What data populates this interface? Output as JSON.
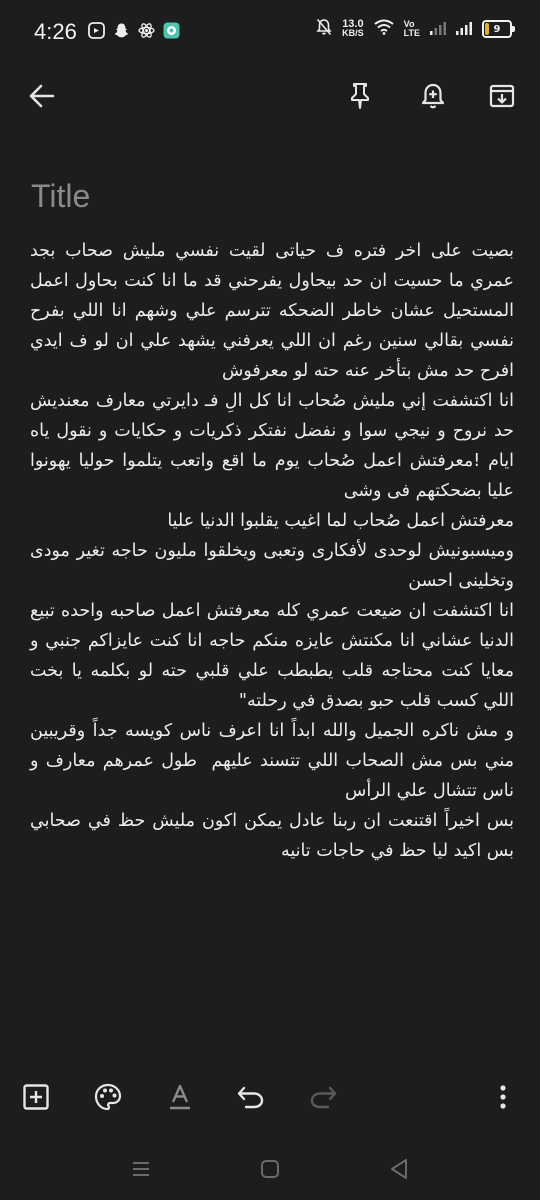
{
  "status_bar": {
    "time": "4:26",
    "net_speed_value": "13.0",
    "net_speed_unit": "KB/S",
    "volte_top": "Vo",
    "volte_bottom": "LTE",
    "battery_level": "9",
    "icons": [
      "notification-app-icon",
      "snapchat-icon",
      "react-icon",
      "messaging-app-icon",
      "mute-bell-icon",
      "wifi-icon",
      "signal-icon",
      "signal-icon",
      "battery-icon"
    ]
  },
  "toolbar": {
    "icons": [
      "back-arrow-icon",
      "pin-icon",
      "add-reminder-icon",
      "archive-icon"
    ]
  },
  "note": {
    "title_placeholder": "Title",
    "body": "بصيت على اخر فتره ف حياتى لقيت نفسي مليش صحاب بجد عمري ما حسيت ان حد بيحاول يفرحني قد ما انا كنت بحاول اعمل المستحيل عشان خاطر الضحكه تترسم علي وشهم انا اللي بفرح نفسي بقالي سنين رغم ان اللي يعرفني يشهد علي ان لو ف ايدي افرح حد مش بتأخر عنه حته لو معرفوش\nانا اكتشفت إني مليش صُحاب انا كل الِ فـ دايرتي معارف معنديش حد نروح و نيجي سوا و نفضل نفتكر ذكريات و حكايات و نقول ياه ايام !معرفتش اعمل صُحاب يوم ما اقع واتعب يتلموا حوليا يهونوا عليا بضحكتهم فى وشى\nمعرفتش اعمل صُحاب لما اغيب يقلبوا الدنيا عليا\nوميسبونيش لوحدى لأفكارى وتعبى ويخلقوا مليون حاجه تغير مودى وتخلينى احسن\nانا اكتشفت ان ضيعت عمري كله معرفتش اعمل صاحبه واحده تبيع الدنيا عشاني انا مكنتش عايزه منكم حاجه انا كنت عايزاكم جنبي و معايا كنت محتاجه قلب يطبطب علي قلبي حته لو بكلمه يا بخت اللي كسب قلب حبو بصدق في رحلته\"\nو مش ناكره الجميل والله ابداً انا اعرف ناس كويسه جداً وقريبين مني بس مش الصحاب اللي تتسند عليهم  طول عمرهم معارف و ناس تتشال علي الرأس\nبس اخيراً اقتنعت ان ربنا عادل يمكن اكون مليش حظ في صحابي بس اكيد ليا حظ في حاجات تانيه"
  },
  "bottom_bar": {
    "icons": [
      "add-box-icon",
      "palette-icon",
      "text-format-icon",
      "undo-icon",
      "redo-icon",
      "more-vert-icon"
    ]
  },
  "nav_bar": {
    "icons": [
      "recents-icon",
      "home-icon",
      "back-triangle-icon"
    ]
  },
  "colors": {
    "background": "#1d1d1d",
    "text": "#ececec",
    "placeholder": "#8a8a8a",
    "icon": "#e6e6e6",
    "battery_fill": "#e0b030"
  }
}
